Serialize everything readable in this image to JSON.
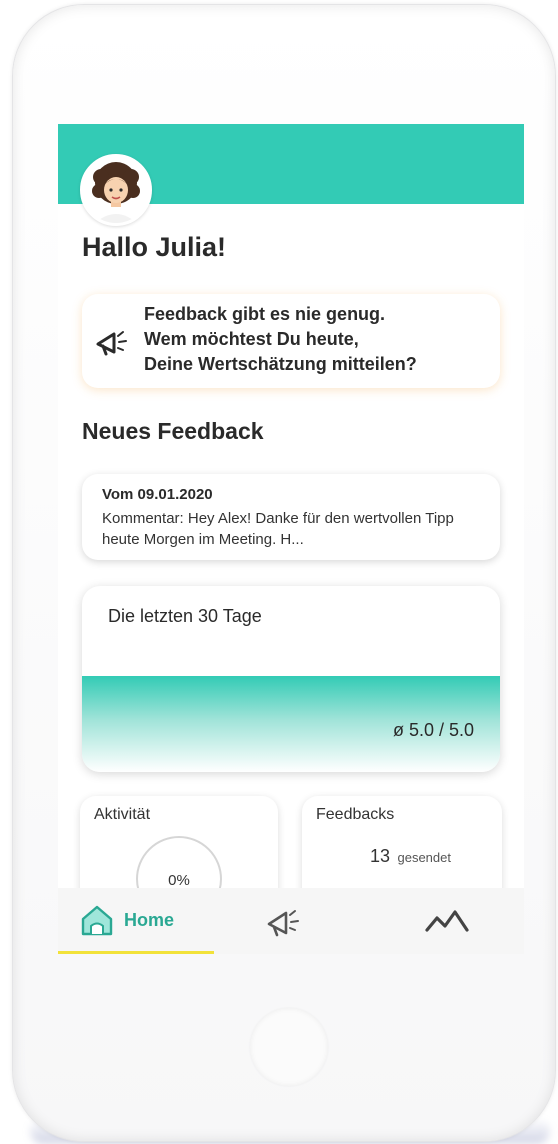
{
  "header": {
    "accent_color": "#33cbb5",
    "avatar_icon": "user-avatar-icon"
  },
  "greeting": "Hallo Julia!",
  "prompt": {
    "icon": "megaphone-icon",
    "text": "Feedback gibt es nie genug.\nWem möchtest Du heute,\nDeine Wertschätzung mitteilen?"
  },
  "new_feedback": {
    "title": "Neues Feedback",
    "items": [
      {
        "date": "Vom 09.01.2020",
        "comment": "Kommentar: Hey Alex! Danke für den wertvollen Tipp heute Morgen im Meeting. H..."
      }
    ]
  },
  "stats": {
    "title": "Die letzten 30 Tage",
    "average": "ø 5.0 / 5.0"
  },
  "activity": {
    "label": "Aktivität",
    "value": "0%",
    "progress": 0
  },
  "feedbacks": {
    "label": "Feedbacks",
    "count": "13",
    "count_label": "gesendet"
  },
  "nav": {
    "home_label": "Home",
    "home_icon": "home-icon",
    "feedback_icon": "megaphone-icon",
    "stats_icon": "activity-chart-icon",
    "active_underline_color": "#f2e23a"
  }
}
